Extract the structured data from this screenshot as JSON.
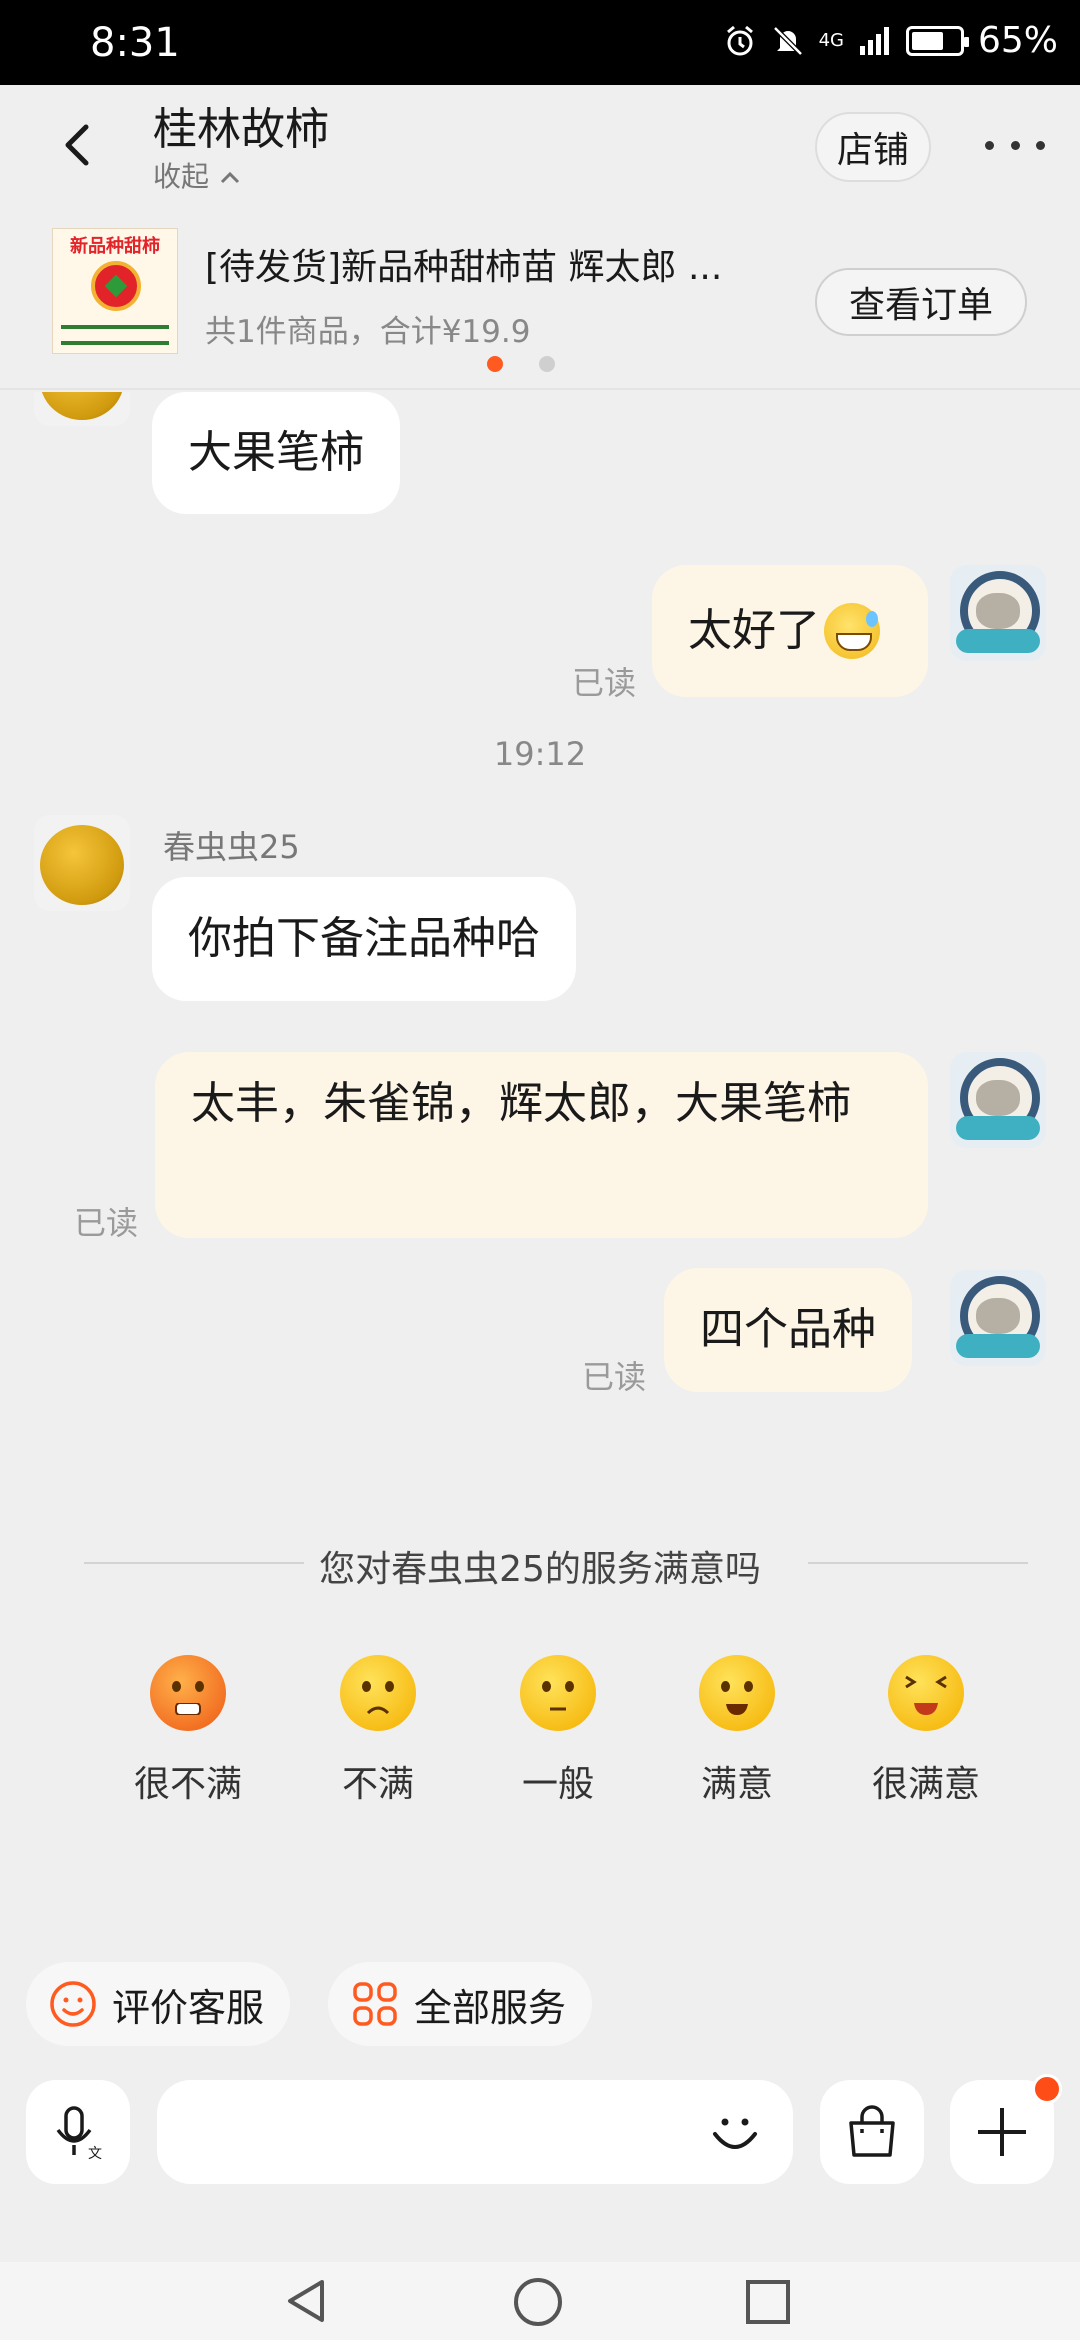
{
  "status_bar": {
    "time": "8:31",
    "network": "4G",
    "battery": "65%"
  },
  "header": {
    "title": "桂林故柿",
    "subtitle": "收起",
    "shop_label": "店铺"
  },
  "order": {
    "title": "[待发货]新品种甜柿苗 辉太郎 ...",
    "summary": "共1件商品，合计¥19.9",
    "view_label": "查看订单",
    "thumb_text": "新品种甜柿",
    "carousel_active": 0,
    "carousel_total": 2
  },
  "messages": {
    "msg1": "大果笔柿",
    "msg2": "太好了",
    "read_label": "已读",
    "timestamp": "19:12",
    "sender": "春虫虫25",
    "msg3": "你拍下备注品种哈",
    "msg4": "太丰，朱雀锦，辉太郎，大果笔柿",
    "msg5": "四个品种"
  },
  "survey": {
    "title": "您对春虫虫25的服务满意吗",
    "options": [
      "很不满",
      "不满",
      "一般",
      "满意",
      "很满意"
    ]
  },
  "quick_actions": {
    "rate": "评价客服",
    "all_services": "全部服务"
  },
  "colors": {
    "accent": "#ff5a1f",
    "bubble_self": "#fdf6e6",
    "bubble_other": "#ffffff"
  }
}
